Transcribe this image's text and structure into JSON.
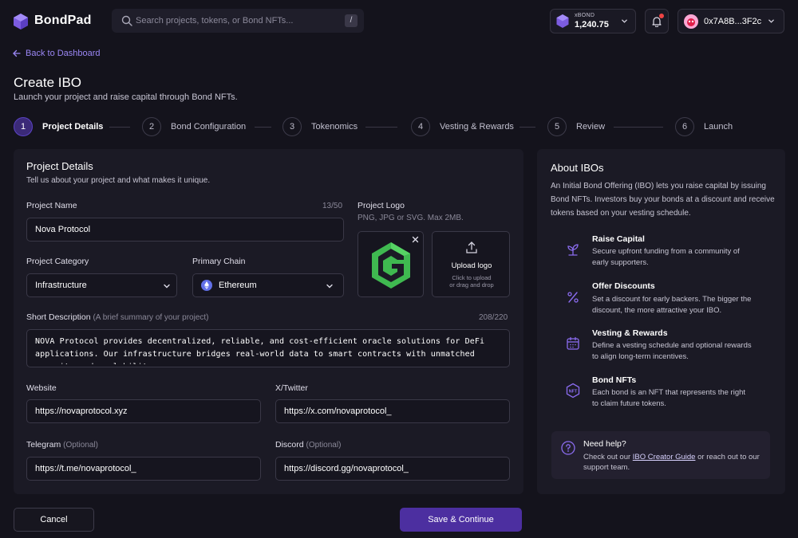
{
  "app": {
    "name": "BondPad"
  },
  "search": {
    "placeholder": "Search projects, tokens, or Bond NFTs...",
    "shortcut": "/"
  },
  "balance": {
    "token": "xBOND",
    "amount": "1,240.75"
  },
  "wallet": {
    "address": "0x7A8B...3F2c"
  },
  "nav": {
    "back_label": "Back to Dashboard"
  },
  "page": {
    "title": "Create IBO",
    "subtitle": "Launch your project and raise capital through Bond NFTs."
  },
  "steps": [
    {
      "number": "1",
      "label": "Project Details",
      "active": true
    },
    {
      "number": "2",
      "label": "Bond Configuration",
      "active": false
    },
    {
      "number": "3",
      "label": "Tokenomics",
      "active": false
    },
    {
      "number": "4",
      "label": "Vesting & Rewards",
      "active": false
    },
    {
      "number": "5",
      "label": "Review",
      "active": false
    },
    {
      "number": "6",
      "label": "Launch",
      "active": false
    }
  ],
  "form": {
    "title": "Project Details",
    "subtitle": "Tell us about your project and what makes it unique.",
    "project_name": {
      "label": "Project Name",
      "value": "Nova Protocol",
      "counter": "13/50"
    },
    "project_logo": {
      "label": "Project Logo",
      "hint": "PNG, JPG or SVG. Max 2MB.",
      "upload_title": "Upload logo",
      "upload_hint_1": "Click to upload",
      "upload_hint_2": "or drag and drop"
    },
    "category": {
      "label": "Project Category",
      "value": "Infrastructure"
    },
    "chain": {
      "label": "Primary Chain",
      "value": "Ethereum"
    },
    "description": {
      "label": "Short Description",
      "hint": "(A brief summary of your project)",
      "counter": "208/220",
      "value": "NOVA Protocol provides decentralized, reliable, and cost-efficient oracle solutions for DeFi applications. Our infrastructure bridges real-world data to smart contracts with unmatched security and scalability."
    },
    "website": {
      "label": "Website",
      "value": "https://novaprotocol.xyz"
    },
    "twitter": {
      "label": "X/Twitter",
      "value": "https://x.com/novaprotocol_"
    },
    "telegram": {
      "label": "Telegram",
      "optional": "(Optional)",
      "value": "https://t.me/novaprotocol_"
    },
    "discord": {
      "label": "Discord",
      "optional": "(Optional)",
      "value": "https://discord.gg/novaprotocol_"
    }
  },
  "about": {
    "title": "About IBOs",
    "description": "An Initial Bond Offering (IBO) lets you raise capital by issuing Bond NFTs. Investors buy your bonds at a discount and receive tokens based on your vesting schedule.",
    "features": [
      {
        "icon": "seedling-icon",
        "title": "Raise Capital",
        "desc": "Secure upfront funding from a community of early supporters."
      },
      {
        "icon": "percent-icon",
        "title": "Offer Discounts",
        "desc": "Set a discount for early backers. The bigger the discount, the more attractive your IBO."
      },
      {
        "icon": "calendar-icon",
        "title": "Vesting & Rewards",
        "desc": "Define a vesting schedule and optional rewards to align long-term incentives."
      },
      {
        "icon": "nft-hexagon-icon",
        "title": "Bond NFTs",
        "desc": "Each bond is an NFT that represents the right to claim future tokens."
      }
    ],
    "help": {
      "title": "Need help?",
      "text_before": "Check out our ",
      "link": "IBO Creator Guide",
      "text_after": " or reach out to our support team."
    }
  },
  "actions": {
    "cancel": "Cancel",
    "save": "Save & Continue"
  },
  "colors": {
    "accent": "#8b6cf0",
    "primary_button": "#4c2fa0",
    "background": "#14131c",
    "card": "#1b1a25",
    "logo_green": "#3fb950"
  }
}
